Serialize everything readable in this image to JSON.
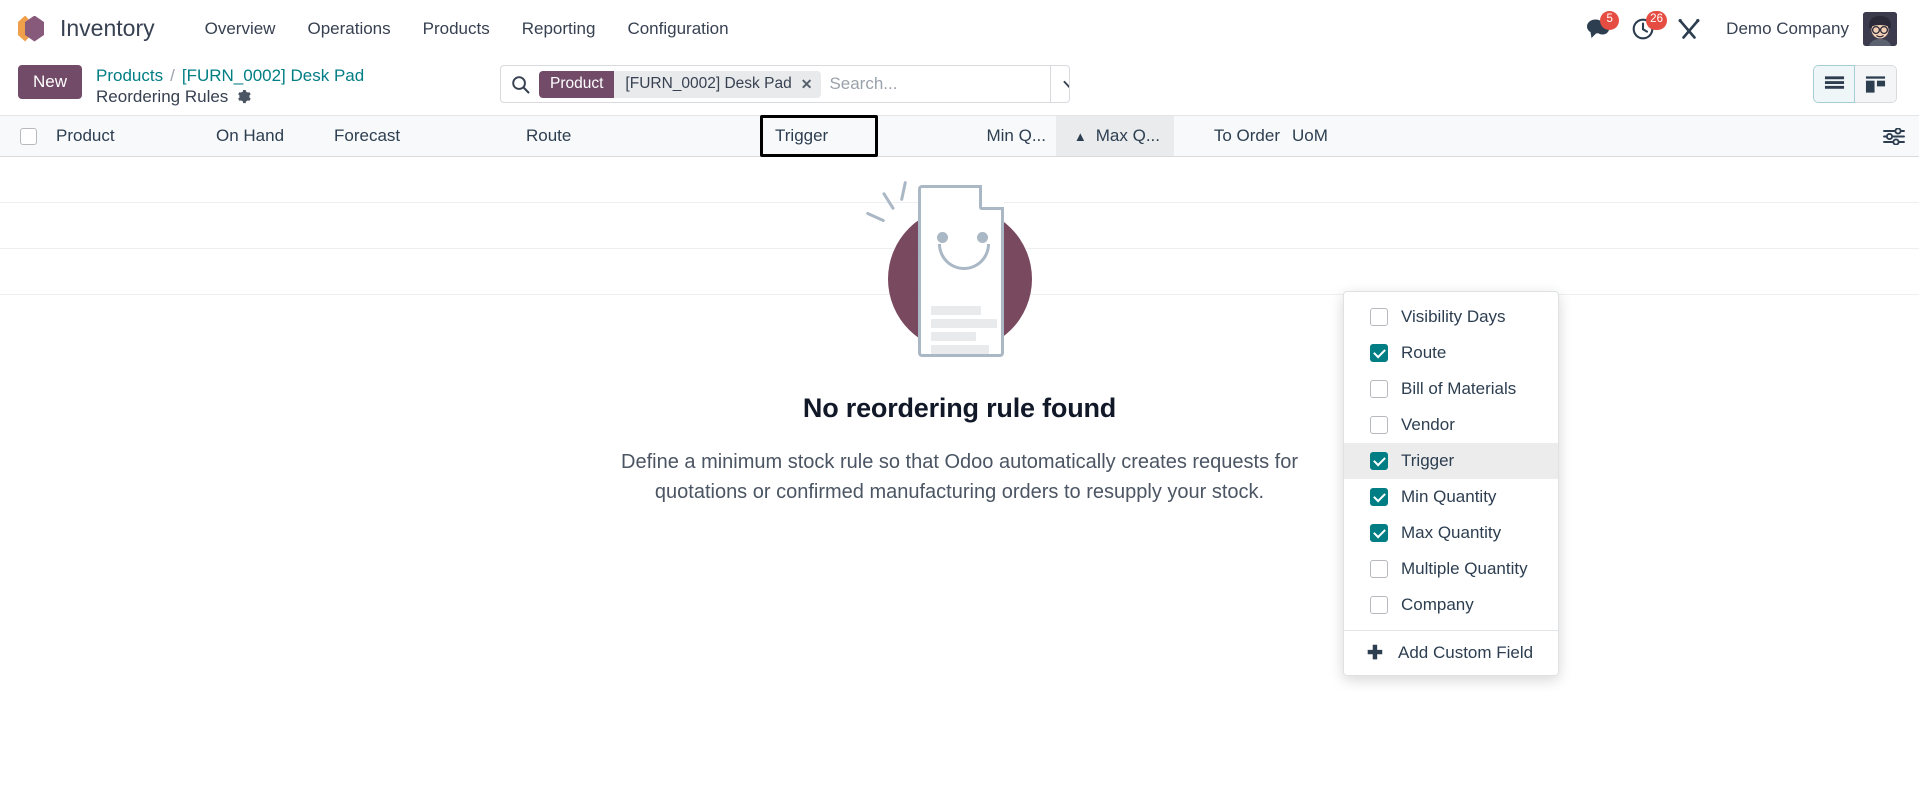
{
  "navbar": {
    "app_name": "Inventory",
    "logo_icon": "odoo-hex-logo",
    "menu": [
      {
        "label": "Overview"
      },
      {
        "label": "Operations"
      },
      {
        "label": "Products"
      },
      {
        "label": "Reporting"
      },
      {
        "label": "Configuration"
      }
    ],
    "messages": {
      "icon": "chat-bubble-icon",
      "count": "5"
    },
    "activities": {
      "icon": "clock-icon",
      "count": "26"
    },
    "debug": {
      "icon": "tools-wrench-icon"
    },
    "company": "Demo Company",
    "avatar_icon": "user-avatar"
  },
  "control_panel": {
    "new_label": "New",
    "breadcrumb": {
      "root": "Products",
      "separator": "/",
      "record": "[FURN_0002] Desk Pad",
      "subtitle": "Reordering Rules",
      "gear_icon": "gear-icon"
    },
    "search": {
      "magnifier_icon": "search-icon",
      "facet_label": "Product",
      "facet_value": "[FURN_0002] Desk Pad",
      "facet_remove_icon": "close-icon",
      "placeholder": "Search...",
      "value": "",
      "dropdown_icon": "chevron-down-icon"
    },
    "views": [
      {
        "name": "list",
        "icon": "list-view-icon",
        "active": true
      },
      {
        "name": "kanban",
        "icon": "kanban-view-icon",
        "active": false
      }
    ]
  },
  "table": {
    "select_all_icon": "checkbox-unchecked",
    "columns": [
      {
        "key": "product",
        "label": "Product"
      },
      {
        "key": "on_hand",
        "label": "On Hand"
      },
      {
        "key": "forecast",
        "label": "Forecast"
      },
      {
        "key": "route",
        "label": "Route"
      },
      {
        "key": "trigger",
        "label": "Trigger"
      },
      {
        "key": "min_q",
        "label": "Min Q..."
      },
      {
        "key": "max_q",
        "label": "Max Q...",
        "sort": "asc",
        "sort_icon": "caret-up-icon"
      },
      {
        "key": "to_order",
        "label": "To Order"
      },
      {
        "key": "uom",
        "label": "UoM"
      }
    ],
    "rows": [],
    "settings_icon": "column-settings-icon"
  },
  "empty_state": {
    "illustration": "smiling-document-illustration",
    "title": "No reordering rule found",
    "description_line1": "Define a minimum stock rule so that Odoo automatically creates requests for",
    "description_line2": "quotations or confirmed manufacturing orders to resupply your stock."
  },
  "optional_columns_dropdown": {
    "items": [
      {
        "label": "Visibility Days",
        "checked": false,
        "hover": false
      },
      {
        "label": "Route",
        "checked": true,
        "hover": false
      },
      {
        "label": "Bill of Materials",
        "checked": false,
        "hover": false
      },
      {
        "label": "Vendor",
        "checked": false,
        "hover": false
      },
      {
        "label": "Trigger",
        "checked": true,
        "hover": true
      },
      {
        "label": "Min Quantity",
        "checked": true,
        "hover": false
      },
      {
        "label": "Max Quantity",
        "checked": true,
        "hover": false
      },
      {
        "label": "Multiple Quantity",
        "checked": false,
        "hover": false
      },
      {
        "label": "Company",
        "checked": false,
        "hover": false
      }
    ],
    "add_custom_field": {
      "label": "Add Custom Field",
      "icon": "plus-icon"
    }
  },
  "colors": {
    "brand_purple": "#714b67",
    "link_teal": "#017e84",
    "badge_red": "#e54d42",
    "checkbox_teal": "#017e84",
    "illustration_circle": "#6e3a51"
  }
}
